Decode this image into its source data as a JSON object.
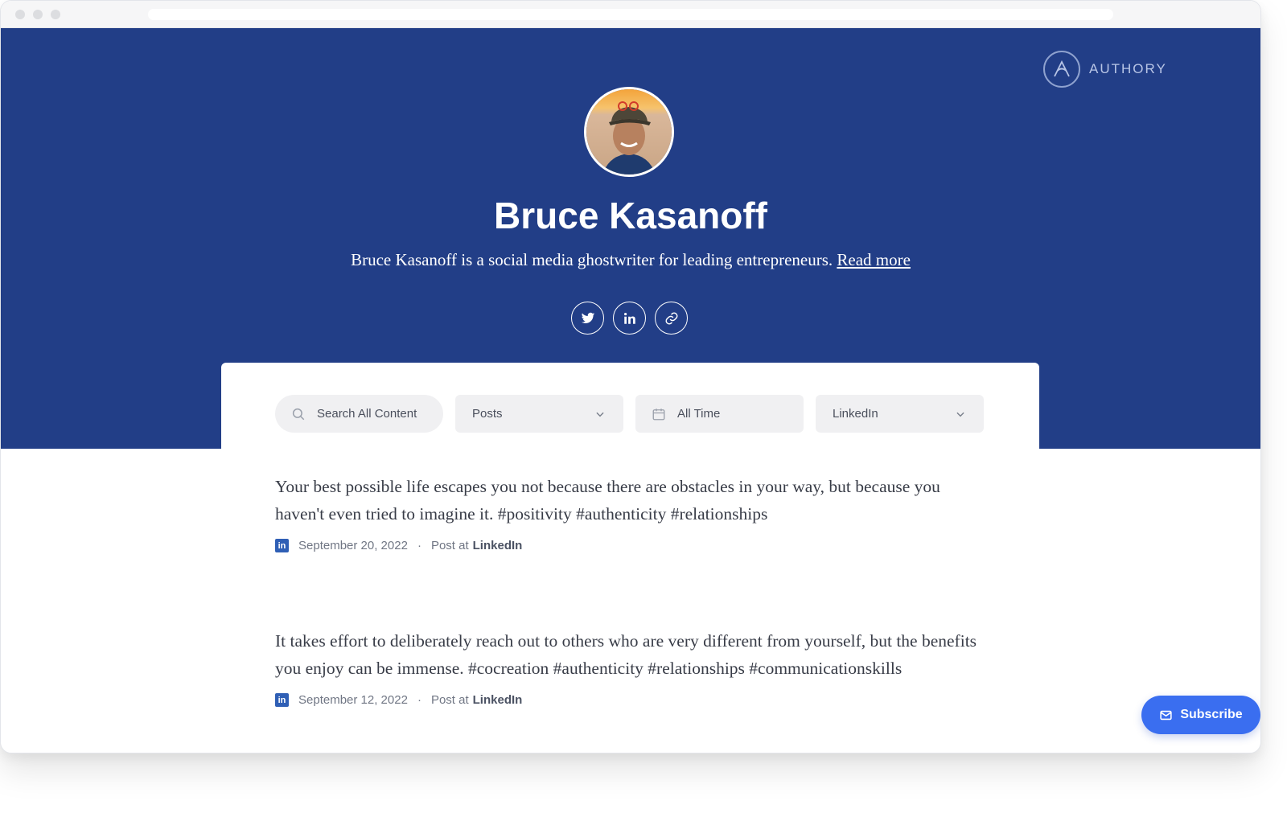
{
  "brand": {
    "name": "AUTHORY",
    "logo_icon": "authory-logo-icon"
  },
  "profile": {
    "name": "Bruce Kasanoff",
    "bio": "Bruce Kasanoff is a social media ghostwriter for leading entrepreneurs.",
    "read_more": "Read more",
    "social_icons": [
      "twitter-icon",
      "linkedin-icon",
      "link-icon"
    ]
  },
  "filters": {
    "search_placeholder": "Search All Content",
    "type": "Posts",
    "time": "All Time",
    "source": "LinkedIn"
  },
  "posts": [
    {
      "text": "Your best possible life escapes you not because there are obstacles in your way, but because you haven't even tried to imagine it. #positivity #authenticity #relationships",
      "date": "September 20, 2022",
      "post_at": "Post at",
      "source": "LinkedIn"
    },
    {
      "text": "It takes effort to deliberately reach out to others who are very different from yourself, but the benefits you enjoy can be immense. #cocreation #authenticity #relationships #communicationskills",
      "date": "September 12, 2022",
      "post_at": "Post at",
      "source": "LinkedIn"
    }
  ],
  "subscribe_label": "Subscribe",
  "colors": {
    "hero": "#223e87",
    "accent": "#3a6ef0"
  }
}
